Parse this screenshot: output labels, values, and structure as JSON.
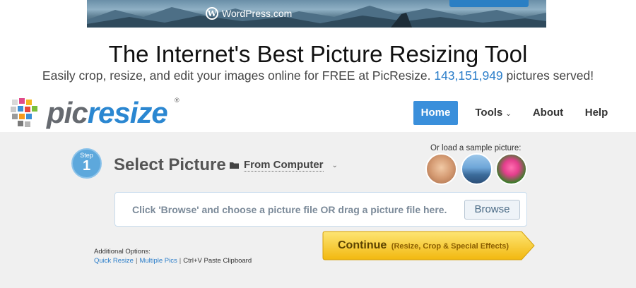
{
  "ad": {
    "brand": "WordPress.com",
    "brand_mark": "W"
  },
  "header": {
    "title": "The Internet's Best Picture Resizing Tool",
    "subtitle_prefix": "Easily crop, resize, and edit your images online for FREE at PicResize.",
    "pictures_count": "143,151,949",
    "subtitle_suffix": "pictures served!"
  },
  "logo": {
    "part1": "pic",
    "part2": "resize",
    "reg": "®"
  },
  "nav": {
    "home": "Home",
    "tools": "Tools",
    "about": "About",
    "help": "Help",
    "chevron": "⌄"
  },
  "step": {
    "word": "Step",
    "number": "1",
    "title": "Select Picture",
    "source": "From Computer",
    "chevron": "⌄"
  },
  "samples": {
    "label": "Or load a sample picture:"
  },
  "upload": {
    "hint": "Click 'Browse' and choose a picture file OR drag a picture file here.",
    "browse": "Browse"
  },
  "continue": {
    "label": "Continue",
    "sub": "(Resize, Crop & Special Effects)"
  },
  "options": {
    "heading": "Additional Options:",
    "quick_resize": "Quick Resize",
    "multiple_pics": "Multiple Pics",
    "paste": "Ctrl+V Paste Clipboard",
    "sep": "|"
  },
  "colors": {
    "brand_blue": "#2b87d1",
    "nav_active": "#3a8fdb",
    "continue_yellow": "#f7c51f"
  }
}
